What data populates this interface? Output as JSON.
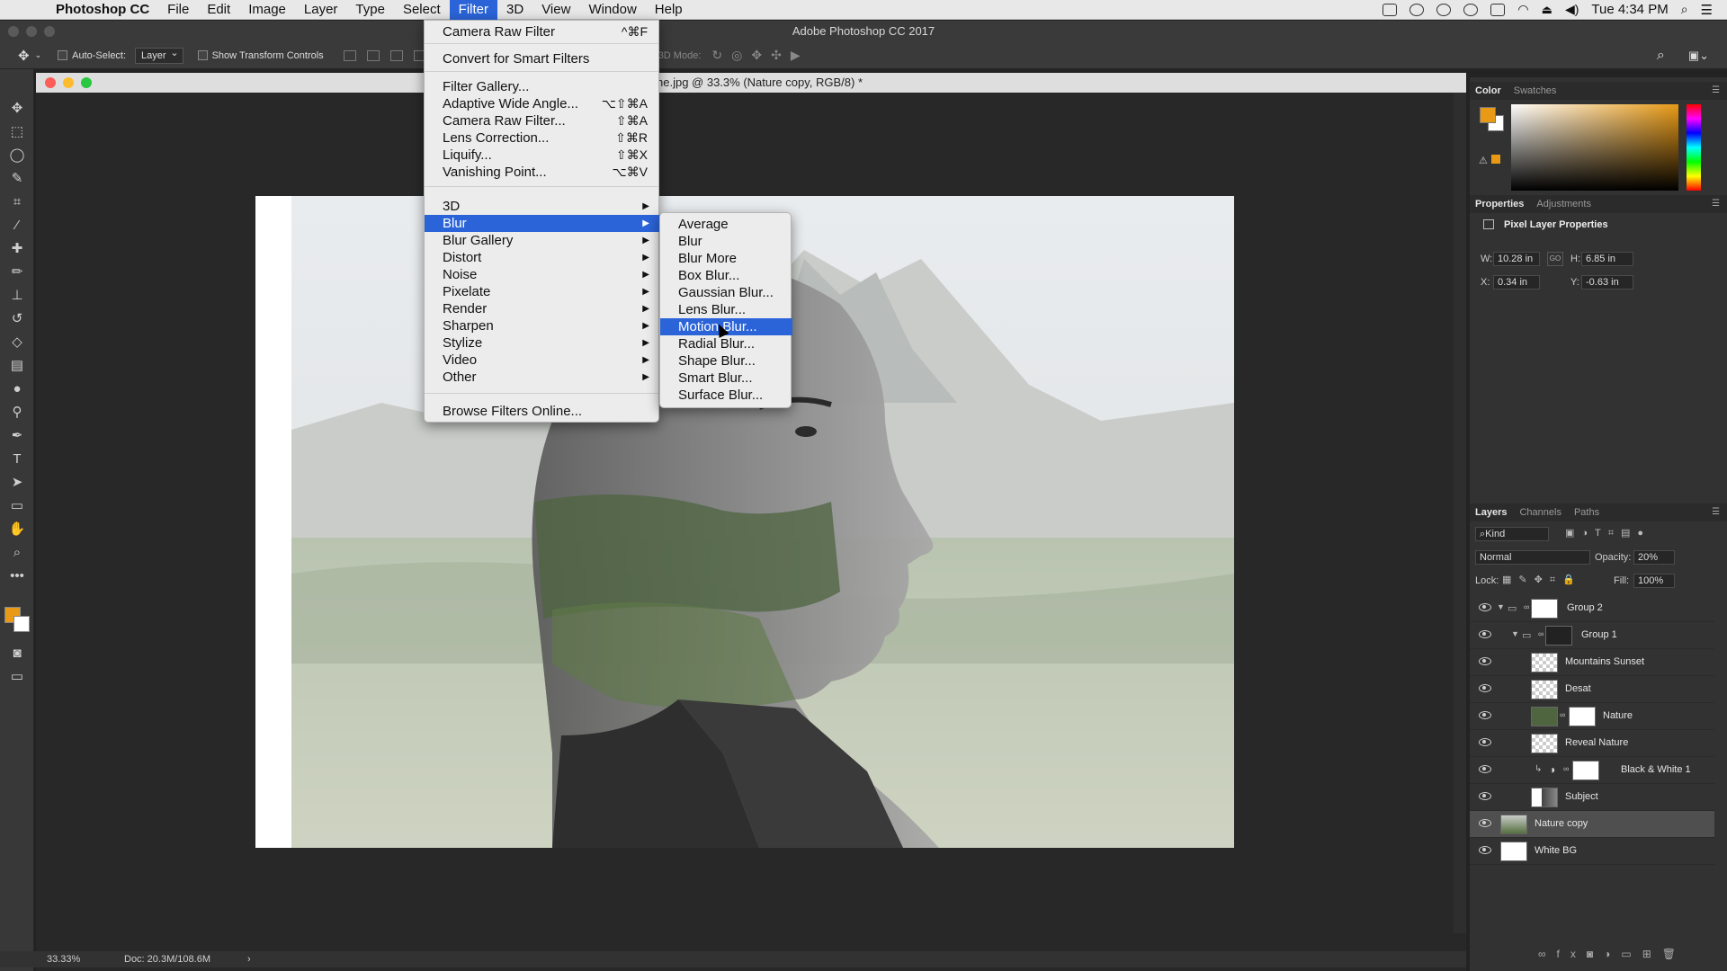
{
  "menubar": {
    "app": "Photoshop CC",
    "items": [
      "File",
      "Edit",
      "Image",
      "Layer",
      "Type",
      "Select",
      "Filter",
      "3D",
      "View",
      "Window",
      "Help"
    ],
    "active": "Filter",
    "clock": "Tue 4:34 PM"
  },
  "window_title": "Adobe Photoshop CC 2017",
  "options": {
    "auto_select_label": "Auto-Select:",
    "auto_select_value": "Layer",
    "show_transform": "Show Transform Controls",
    "mode_3d": "3D Mode:"
  },
  "doc_title": "ne.jpg @ 33.3% (Nature copy, RGB/8) *",
  "status": {
    "zoom": "33.33%",
    "doc": "Doc: 20.3M/108.6M",
    "arrow": "›"
  },
  "filter_menu": {
    "top": [
      {
        "label": "Camera Raw Filter",
        "sc": "^⌘F"
      },
      {
        "label": "Convert for Smart Filters",
        "sc": ""
      }
    ],
    "filters": [
      {
        "label": "Filter Gallery...",
        "sc": ""
      },
      {
        "label": "Adaptive Wide Angle...",
        "sc": "⌥⇧⌘A"
      },
      {
        "label": "Camera Raw Filter...",
        "sc": "⇧⌘A"
      },
      {
        "label": "Lens Correction...",
        "sc": "⇧⌘R"
      },
      {
        "label": "Liquify...",
        "sc": "⇧⌘X"
      },
      {
        "label": "Vanishing Point...",
        "sc": "⌥⌘V"
      }
    ],
    "groups": [
      "3D",
      "Blur",
      "Blur Gallery",
      "Distort",
      "Noise",
      "Pixelate",
      "Render",
      "Sharpen",
      "Stylize",
      "Video",
      "Other"
    ],
    "highlighted": "Blur",
    "bottom": "Browse Filters Online..."
  },
  "blur_menu": {
    "items": [
      "Average",
      "Blur",
      "Blur More",
      "Box Blur...",
      "Gaussian Blur...",
      "Lens Blur...",
      "Motion Blur...",
      "Radial Blur...",
      "Shape Blur...",
      "Smart Blur...",
      "Surface Blur..."
    ],
    "highlighted": "Motion Blur..."
  },
  "color_panel": {
    "tabs": [
      "Color",
      "Swatches"
    ],
    "fg": "#e89a16",
    "bg": "#ffffff"
  },
  "properties_panel": {
    "tabs": [
      "Properties",
      "Adjustments"
    ],
    "title": "Pixel Layer Properties",
    "w_label": "W:",
    "w": "10.28 in",
    "h_label": "H:",
    "h": "6.85 in",
    "x_label": "X:",
    "x": "0.34 in",
    "y_label": "Y:",
    "y": "-0.63 in",
    "link": "GO"
  },
  "layers_panel": {
    "tabs": [
      "Layers",
      "Channels",
      "Paths"
    ],
    "kind": "Kind",
    "blend": "Normal",
    "opacity_label": "Opacity:",
    "opacity": "20%",
    "lock_label": "Lock:",
    "fill_label": "Fill:",
    "fill": "100%",
    "layers": [
      {
        "name": "Group 2",
        "type": "group",
        "indent": 0
      },
      {
        "name": "Group 1",
        "type": "group",
        "indent": 1
      },
      {
        "name": "Mountains Sunset",
        "type": "layer",
        "indent": 2
      },
      {
        "name": "Desat",
        "type": "layer",
        "indent": 2
      },
      {
        "name": "Nature",
        "type": "layer",
        "indent": 2
      },
      {
        "name": "Reveal Nature",
        "type": "layer",
        "indent": 2
      },
      {
        "name": "Black & White 1",
        "type": "adjust",
        "indent": 2
      },
      {
        "name": "Subject",
        "type": "layer",
        "indent": 2
      },
      {
        "name": "Nature copy",
        "type": "layer",
        "indent": 0,
        "selected": true
      },
      {
        "name": "White BG",
        "type": "layer",
        "indent": 0
      }
    ]
  }
}
